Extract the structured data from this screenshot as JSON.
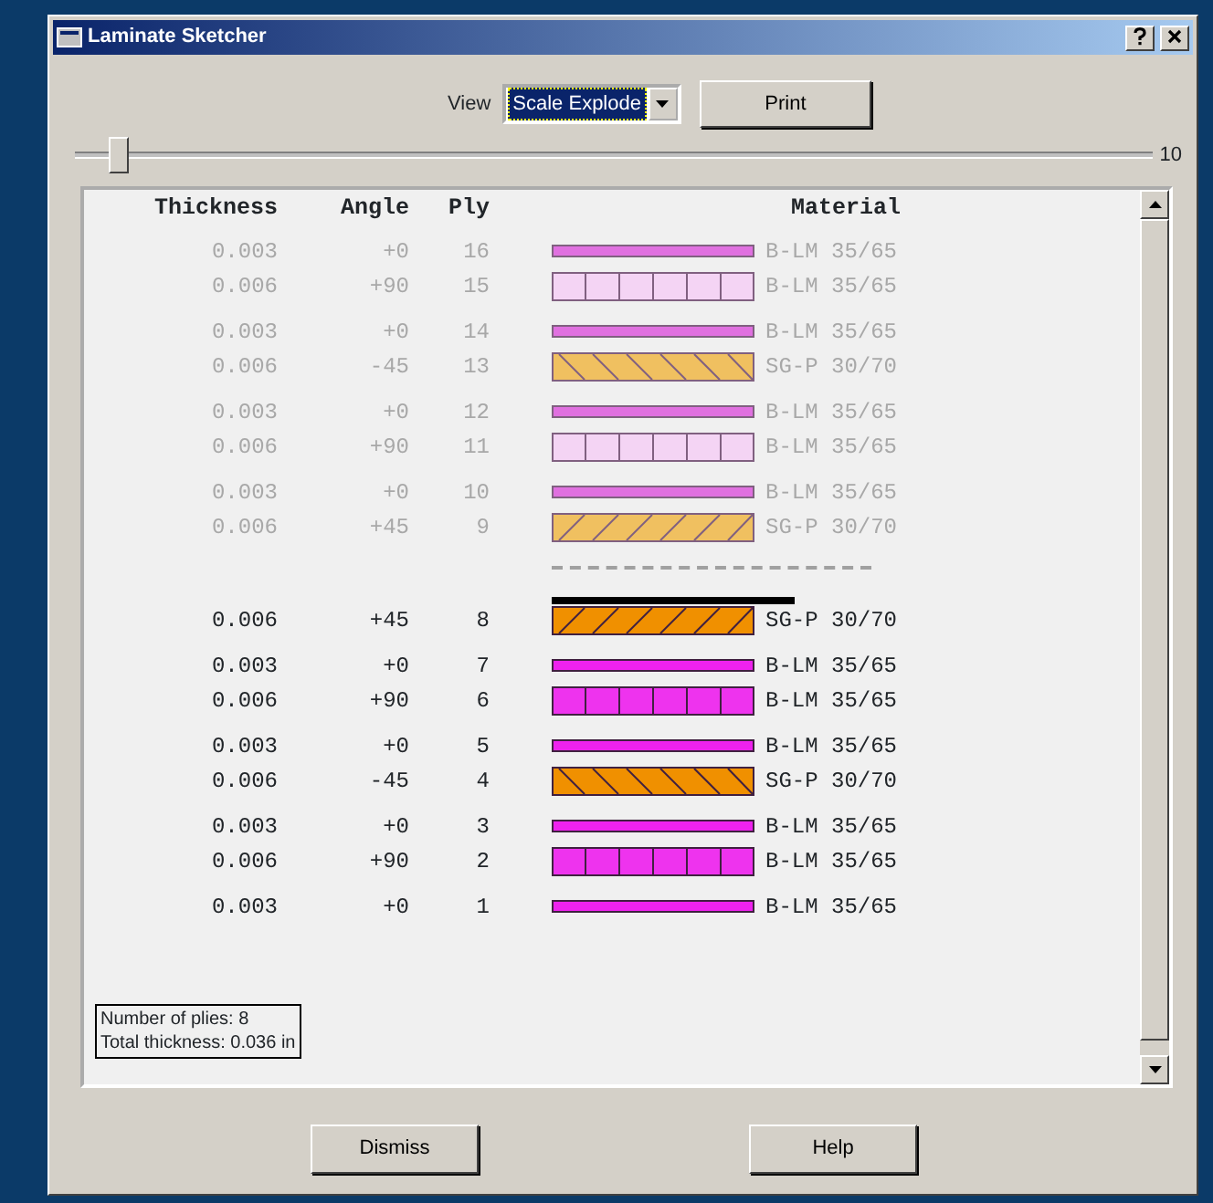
{
  "window": {
    "title": "Laminate Sketcher"
  },
  "toolbar": {
    "view_label": "View",
    "view_value": "Scale Explode",
    "print_button": "Print"
  },
  "slider": {
    "level": 0.04,
    "reading": "10"
  },
  "columns": [
    "Thickness",
    "Angle",
    "Ply",
    "Material"
  ],
  "sections": [
    {
      "faded": true,
      "groups": [
        {
          "plies": [
            {
              "thickness": "0.003",
              "angle": "+0",
              "ply": "16",
              "kind": "thin",
              "material": "B-LM 35/65",
              "selected": false
            },
            {
              "thickness": "0.006",
              "angle": "+90",
              "ply": "15",
              "kind": "grid",
              "material": "B-LM 35/65",
              "selected": false
            }
          ]
        },
        {
          "plies": [
            {
              "thickness": "0.003",
              "angle": "+0",
              "ply": "14",
              "kind": "thin",
              "material": "B-LM 35/65",
              "selected": false
            },
            {
              "thickness": "0.006",
              "angle": "-45",
              "ply": "13",
              "kind": "hatch-neg",
              "material": "SG-P 30/70",
              "selected": false
            }
          ]
        },
        {
          "plies": [
            {
              "thickness": "0.003",
              "angle": "+0",
              "ply": "12",
              "kind": "thin",
              "material": "B-LM 35/65",
              "selected": false
            },
            {
              "thickness": "0.006",
              "angle": "+90",
              "ply": "11",
              "kind": "grid",
              "material": "B-LM 35/65",
              "selected": false
            }
          ]
        },
        {
          "plies": [
            {
              "thickness": "0.003",
              "angle": "+0",
              "ply": "10",
              "kind": "thin",
              "material": "B-LM 35/65",
              "selected": false
            },
            {
              "thickness": "0.006",
              "angle": "+45",
              "ply": "9",
              "kind": "hatch-pos",
              "material": "SG-P 30/70",
              "selected": false
            }
          ]
        }
      ]
    },
    {
      "faded": false,
      "groups": [
        {
          "plies": [
            {
              "thickness": "0.006",
              "angle": "+45",
              "ply": "8",
              "kind": "hatch-pos",
              "material": "SG-P 30/70",
              "selected": true
            }
          ]
        },
        {
          "plies": [
            {
              "thickness": "0.003",
              "angle": "+0",
              "ply": "7",
              "kind": "thin",
              "material": "B-LM 35/65",
              "selected": false
            },
            {
              "thickness": "0.006",
              "angle": "+90",
              "ply": "6",
              "kind": "grid",
              "material": "B-LM 35/65",
              "selected": false
            }
          ]
        },
        {
          "plies": [
            {
              "thickness": "0.003",
              "angle": "+0",
              "ply": "5",
              "kind": "thin",
              "material": "B-LM 35/65",
              "selected": false
            },
            {
              "thickness": "0.006",
              "angle": "-45",
              "ply": "4",
              "kind": "hatch-neg",
              "material": "SG-P 30/70",
              "selected": false
            }
          ]
        },
        {
          "plies": [
            {
              "thickness": "0.003",
              "angle": "+0",
              "ply": "3",
              "kind": "thin",
              "material": "B-LM 35/65",
              "selected": false
            },
            {
              "thickness": "0.006",
              "angle": "+90",
              "ply": "2",
              "kind": "grid",
              "material": "B-LM 35/65",
              "selected": false
            }
          ]
        },
        {
          "plies": [
            {
              "thickness": "0.003",
              "angle": "+0",
              "ply": "1",
              "kind": "thin",
              "material": "B-LM 35/65",
              "selected": false
            }
          ]
        }
      ]
    }
  ],
  "summary": [
    "Number of plies: 8",
    "Total thickness: 0.036 in"
  ],
  "buttons": [
    "Dismiss",
    "Help"
  ]
}
